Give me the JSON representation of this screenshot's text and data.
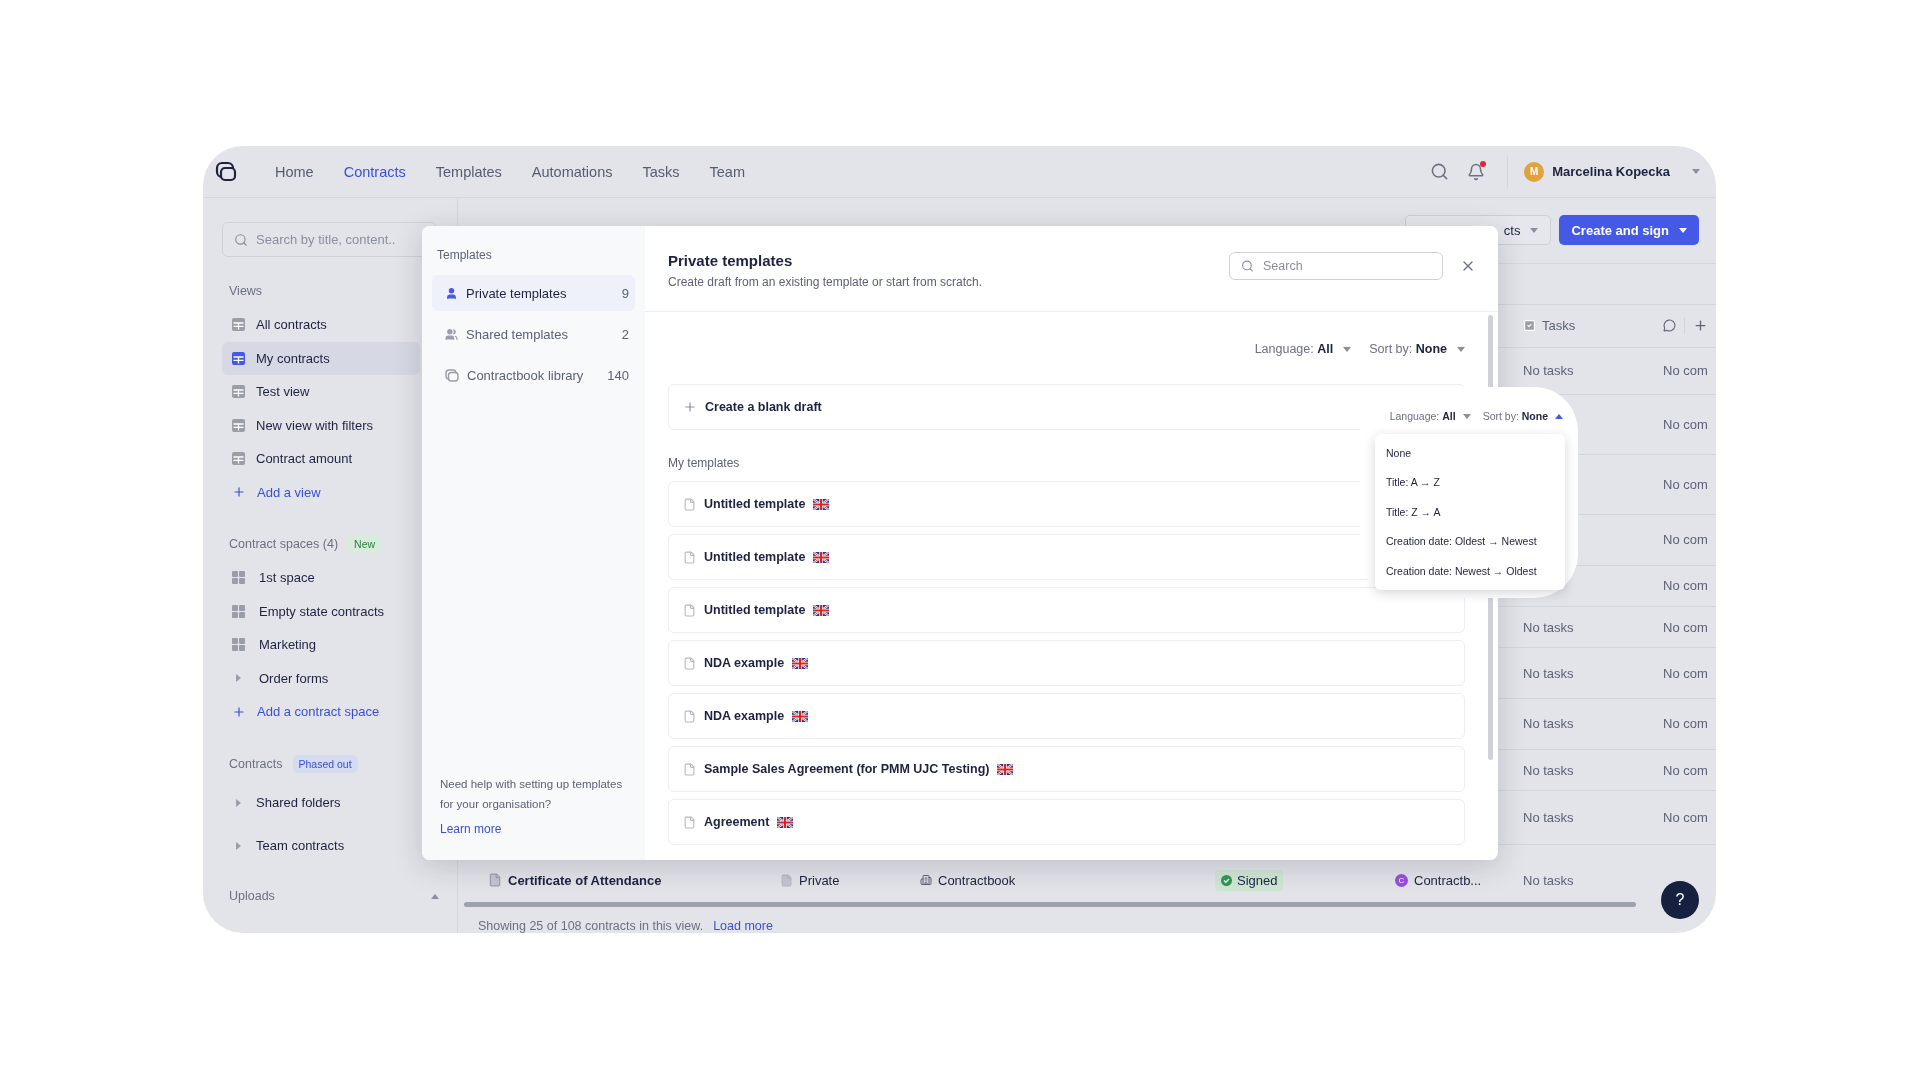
{
  "nav": {
    "items": [
      {
        "label": "Home",
        "selected": false
      },
      {
        "label": "Contracts",
        "selected": true
      },
      {
        "label": "Templates",
        "selected": false
      },
      {
        "label": "Automations",
        "selected": false
      },
      {
        "label": "Tasks",
        "selected": false
      },
      {
        "label": "Team",
        "selected": false
      }
    ],
    "notifications_unread": true,
    "user": {
      "initial": "M",
      "name": "Marcelina Kopecka"
    }
  },
  "sidebar": {
    "search_placeholder": "Search by title, content..",
    "sections": [
      {
        "title": "Views",
        "items": [
          {
            "label": "All contracts",
            "kind": "view",
            "selected": false
          },
          {
            "label": "My contracts",
            "kind": "view",
            "selected": true
          },
          {
            "label": "Test view",
            "kind": "view",
            "selected": false
          },
          {
            "label": "New view with filters",
            "kind": "view",
            "selected": false
          },
          {
            "label": "Contract amount",
            "kind": "view",
            "selected": false
          }
        ],
        "add": "Add a view"
      },
      {
        "title": "Contract spaces (4)",
        "badge": {
          "text": "New",
          "color": "#d7ecdc"
        },
        "items": [
          {
            "label": "1st space",
            "kind": "space",
            "selected": false
          },
          {
            "label": "Empty state contracts",
            "kind": "space",
            "selected": false
          },
          {
            "label": "Marketing",
            "kind": "space",
            "selected": false
          },
          {
            "label": "Order forms",
            "kind": "folder",
            "selected": false
          }
        ],
        "add": "Add a contract space"
      },
      {
        "title": "Contracts",
        "badge": {
          "text": "Phased out",
          "color": "#d5dcf0"
        },
        "items": [
          {
            "label": "Shared folders",
            "kind": "folder",
            "selected": false
          },
          {
            "label": "Team contracts",
            "kind": "folder",
            "selected": false
          }
        ]
      },
      {
        "title": "Uploads",
        "expanded": true
      }
    ]
  },
  "toolbar": {
    "partial_button": "cts",
    "create_button": "Create and sign"
  },
  "table": {
    "column": "Tasks",
    "rows": [
      {
        "tasks": "No tasks",
        "comments": "No com"
      },
      {
        "comments": "No com"
      },
      {
        "comments": "No com"
      },
      {
        "comments": "No com"
      },
      {
        "comments": "No com"
      },
      {
        "tasks": "No tasks",
        "comments": "No com"
      },
      {
        "tasks": "No tasks",
        "comments": "No com"
      },
      {
        "tasks": "No tasks",
        "comments": "No com"
      },
      {
        "tasks": "No tasks",
        "comments": "No com"
      },
      {
        "tasks": "No tasks",
        "comments": "No com"
      }
    ],
    "last_row": {
      "name": "Certificate of Attendance",
      "visibility": "Private",
      "owner": "Contractbook",
      "status": "Signed",
      "party_initial": "C",
      "party": "Contractb...",
      "tasks": "No tasks"
    },
    "footer": {
      "summary": "Showing 25 of 108 contracts in this view.",
      "link": "Load more"
    }
  },
  "templates_modal": {
    "sidebar_title": "Templates",
    "categories": [
      {
        "label": "Private templates",
        "count": "9",
        "kind": "person",
        "selected": true
      },
      {
        "label": "Shared templates",
        "count": "2",
        "kind": "people",
        "selected": false
      },
      {
        "label": "Contractbook library",
        "count": "140",
        "kind": "library",
        "selected": false
      }
    ],
    "help_text": "Need help with setting up templates for your organisation?",
    "help_link": "Learn more",
    "title": "Private templates",
    "subtitle": "Create draft from an existing template or start from scratch.",
    "search_placeholder": "Search",
    "filters": {
      "language_label": "Language:",
      "language": "All",
      "sort_label": "Sort by:",
      "sort": "None",
      "open": false
    },
    "blank_draft": "Create a blank draft",
    "section_title": "My templates",
    "templates": [
      {
        "name": "Untitled template"
      },
      {
        "name": "Untitled template"
      },
      {
        "name": "Untitled template"
      },
      {
        "name": "NDA example"
      },
      {
        "name": "NDA example"
      },
      {
        "name": "Sample Sales Agreement (for PMM UJC Testing)"
      },
      {
        "name": "Agreement"
      }
    ],
    "sort_popup": {
      "filters": {
        "language_label": "Language:",
        "language": "All",
        "sort_label": "Sort by:",
        "sort": "None",
        "open": true
      },
      "options": [
        "None",
        "Title: A → Z",
        "Title: Z → A",
        "Creation date: Oldest → Newest",
        "Creation date: Newest → Oldest"
      ]
    }
  },
  "help_button": "?"
}
